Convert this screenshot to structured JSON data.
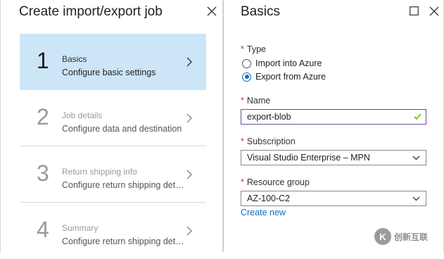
{
  "left_blade": {
    "title": "Create import/export job",
    "steps": [
      {
        "number": "1",
        "title": "Basics",
        "subtitle": "Configure basic settings",
        "active": true
      },
      {
        "number": "2",
        "title": "Job details",
        "subtitle": "Configure data and destination",
        "active": false
      },
      {
        "number": "3",
        "title": "Return shipping info",
        "subtitle": "Configure return shipping deta...",
        "active": false
      },
      {
        "number": "4",
        "title": "Summary",
        "subtitle": "Configure return shipping deta...",
        "active": false
      }
    ]
  },
  "right_blade": {
    "title": "Basics",
    "type": {
      "label": "Type",
      "options": [
        {
          "label": "Import into Azure",
          "selected": false
        },
        {
          "label": "Export from Azure",
          "selected": true
        }
      ]
    },
    "name": {
      "label": "Name",
      "value": "export-blob",
      "valid": true
    },
    "subscription": {
      "label": "Subscription",
      "value": "Visual Studio Enterprise – MPN"
    },
    "resource_group": {
      "label": "Resource group",
      "value": "AZ-100-C2",
      "create_new": "Create new"
    }
  },
  "watermark": {
    "logo": "K",
    "text": "创新互联"
  },
  "colors": {
    "active_step_bg": "#cde6f7",
    "accent": "#0f6cbd",
    "required": "#c0392b",
    "valid": "#6bb700"
  }
}
